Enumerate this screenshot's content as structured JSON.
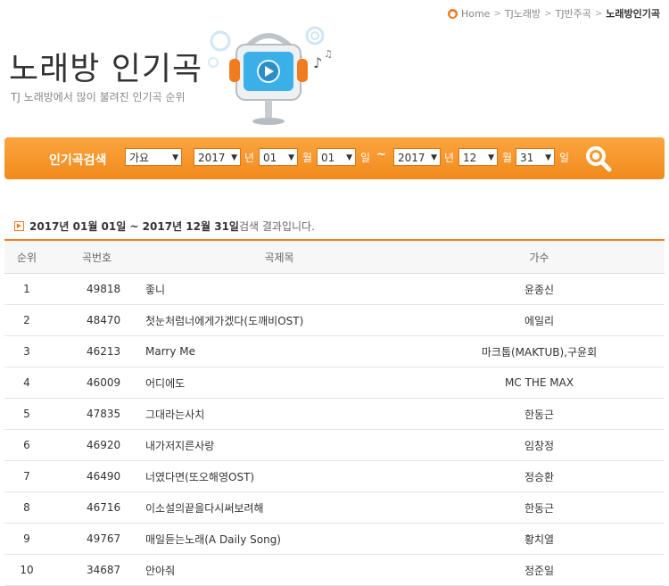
{
  "breadcrumb": {
    "items": [
      "Home",
      "TJ노래방",
      "TJ반주곡"
    ],
    "current": "노래방인기곡"
  },
  "page": {
    "title": "노래방 인기곡",
    "subtitle": "TJ 노래방에서 많이 불려진 인기곡 순위"
  },
  "search": {
    "label": "인기곡검색",
    "genre": "가요",
    "from": {
      "year": "2017",
      "month": "01",
      "day": "01"
    },
    "to": {
      "year": "2017",
      "month": "12",
      "day": "31"
    },
    "units": {
      "year": "년",
      "month": "월",
      "day": "일"
    },
    "separator": "~"
  },
  "result": {
    "range": "2017년 01월 01일 ~ 2017년 12월 31일",
    "suffix": " 검색 결과입니다."
  },
  "table": {
    "headers": {
      "rank": "순위",
      "no": "곡번호",
      "title": "곡제목",
      "artist": "가수"
    },
    "rows": [
      {
        "rank": "1",
        "no": "49818",
        "title": "좋니",
        "artist": "윤종신"
      },
      {
        "rank": "2",
        "no": "48470",
        "title": "첫눈처럼너에게가겠다(도깨비OST)",
        "artist": "에일리"
      },
      {
        "rank": "3",
        "no": "46213",
        "title": "Marry Me",
        "artist": "마크툽(MAKTUB),구윤회"
      },
      {
        "rank": "4",
        "no": "46009",
        "title": "어디에도",
        "artist": "MC THE MAX"
      },
      {
        "rank": "5",
        "no": "47835",
        "title": "그대라는사치",
        "artist": "한동근"
      },
      {
        "rank": "6",
        "no": "46920",
        "title": "내가저지른사랑",
        "artist": "임창정"
      },
      {
        "rank": "7",
        "no": "46490",
        "title": "너였다면(또오해영OST)",
        "artist": "정승환"
      },
      {
        "rank": "8",
        "no": "46716",
        "title": "이소설의끝을다시써보려해",
        "artist": "한동근"
      },
      {
        "rank": "9",
        "no": "49767",
        "title": "매일듣는노래(A Daily Song)",
        "artist": "황치열"
      },
      {
        "rank": "10",
        "no": "34687",
        "title": "안아줘",
        "artist": "정준일"
      }
    ]
  },
  "colors": {
    "accent": "#f07c1f",
    "bar_top": "#fba53f",
    "bar_bottom": "#f18a1c"
  },
  "icons": {
    "search": "magnifier-icon",
    "home": "home-icon",
    "mascot": "monitor-headphones-illustration"
  }
}
